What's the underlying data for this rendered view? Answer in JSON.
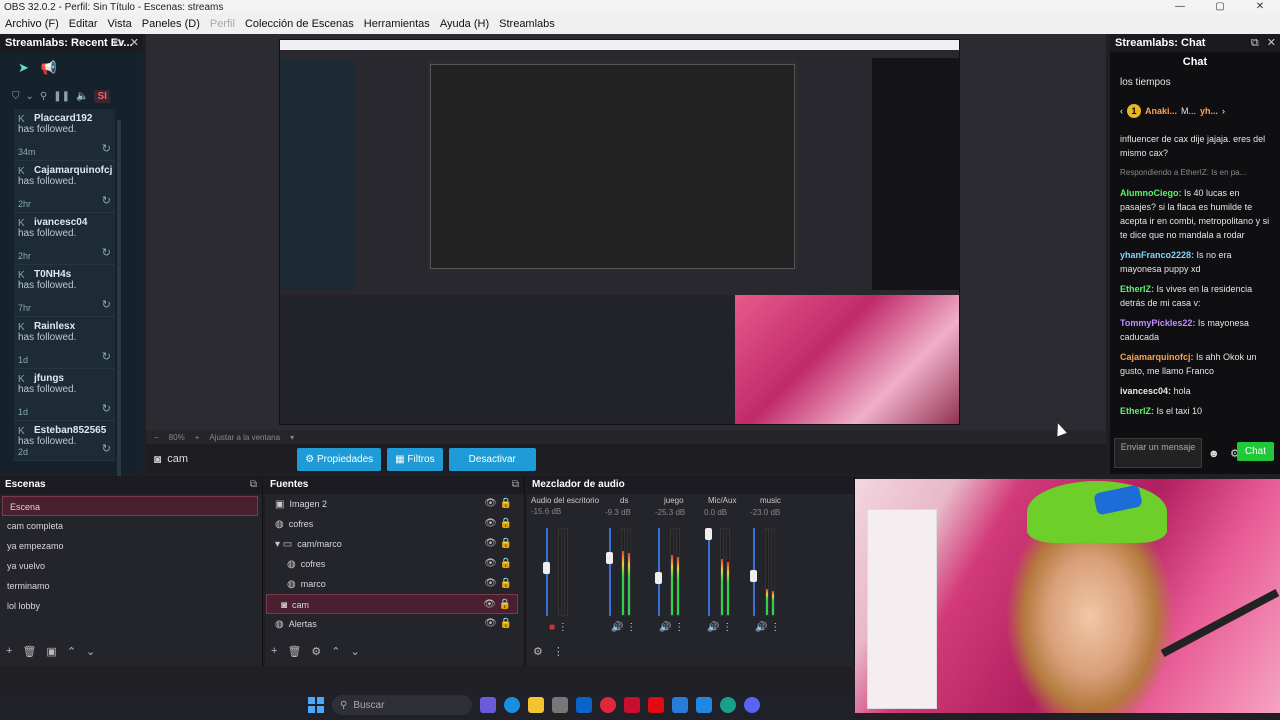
{
  "window": {
    "title": "OBS 32.0.2 - Perfil: Sin Título - Escenas: streams",
    "controls": [
      "—",
      "▢",
      "✕"
    ]
  },
  "menu": [
    {
      "label": "Archivo (F)",
      "disabled": false
    },
    {
      "label": "Editar",
      "disabled": false
    },
    {
      "label": "Vista",
      "disabled": false
    },
    {
      "label": "Paneles (D)",
      "disabled": false
    },
    {
      "label": "Perfil",
      "disabled": true
    },
    {
      "label": "Colección de Escenas",
      "disabled": false
    },
    {
      "label": "Herramientas",
      "disabled": false
    },
    {
      "label": "Ayuda (H)",
      "disabled": false
    },
    {
      "label": "Streamlabs",
      "disabled": false
    }
  ],
  "left_dock": {
    "title": "Streamlabs: Recent Ev...",
    "filter_badge": "SI",
    "events": [
      {
        "name": "Placcard192",
        "action": "has followed.",
        "time": "34m"
      },
      {
        "name": "Cajamarquinofcj",
        "action": "has followed.",
        "time": "2hr"
      },
      {
        "name": "ivancesc04",
        "action": "has followed.",
        "time": "2hr"
      },
      {
        "name": "T0NH4s",
        "action": "has followed.",
        "time": "7hr"
      },
      {
        "name": "Rainlesx",
        "action": "has followed.",
        "time": "1d"
      },
      {
        "name": "jfungs",
        "action": "has followed.",
        "time": "1d"
      },
      {
        "name": "Esteban852565",
        "action": "has followed.",
        "time": "2d"
      }
    ]
  },
  "preview": {
    "zoom": "80%",
    "fit_label": "Ajustar a la ventana"
  },
  "context_bar": {
    "source_name": "cam",
    "properties_label": "Propiedades",
    "filters_label": "Filtros",
    "deactivate_label": "Desactivar"
  },
  "chat_dock": {
    "title": "Streamlabs: Chat",
    "header": "Chat",
    "top_line": "los tiempos",
    "leaderboard": {
      "first": "Anaki...",
      "first_count": "1",
      "second": "M...",
      "second_count": "1",
      "third": "yh...",
      "third_count": "1"
    },
    "messages": [
      {
        "user": "",
        "text": "influencer de cax dije jajaja. eres del mismo cax?",
        "color": "white"
      },
      {
        "user": "",
        "reply": "Respondiendo a EtherIZ: Is en pa...",
        "text": "",
        "color": "reply"
      },
      {
        "user": "AlumnoCiego:",
        "text": "Is 40 lucas en pasajes? si la flaca es humilde te acepta ir en combi, metropolitano y si te dice que no mandala a rodar",
        "color": "green"
      },
      {
        "user": "yhanFranco2228:",
        "text": "Is no era mayonesa puppy xd",
        "color": "blue"
      },
      {
        "user": "EtherIZ:",
        "text": "Is vives en la residencia detrás de mi casa v:",
        "color": "green"
      },
      {
        "user": "TommyPickles22:",
        "text": "Is mayonesa caducada",
        "color": "purple"
      },
      {
        "user": "Cajamarquinofcj:",
        "text": "Is ahh Okok un gusto, me llamo Franco",
        "color": "orange"
      },
      {
        "user": "ivancesc04:",
        "text": "hola",
        "color": "white"
      },
      {
        "user": "EtherIZ:",
        "text": "Is el taxi 10",
        "color": "green"
      }
    ],
    "input_placeholder": "Enviar un mensaje",
    "send_label": "Chat"
  },
  "scenes": {
    "title": "Escenas",
    "items": [
      "Escena",
      "cam completa",
      "ya empezamo",
      "ya vuelvo",
      "terminamo",
      "lol lobby"
    ],
    "selected_index": 0
  },
  "sources": {
    "title": "Fuentes",
    "items": [
      {
        "label": "Imagen 2",
        "icon": "image-icon",
        "indent": 0
      },
      {
        "label": "cofres",
        "icon": "browser-icon",
        "indent": 0
      },
      {
        "label": "cam/marco",
        "icon": "folder-icon",
        "indent": 0
      },
      {
        "label": "cofres",
        "icon": "browser-icon",
        "indent": 1
      },
      {
        "label": "marco",
        "icon": "browser-icon",
        "indent": 1
      },
      {
        "label": "cam",
        "icon": "camera-icon",
        "indent": 1
      },
      {
        "label": "Alertas",
        "icon": "browser-icon",
        "indent": 0
      }
    ],
    "selected_index": 5
  },
  "mixer": {
    "title": "Mezclador de audio",
    "channels": [
      {
        "name": "Audio del escritorio",
        "db": "-15.6 dB",
        "level": 0.0
      },
      {
        "name": "ds",
        "db": "-9.3 dB",
        "level": 0.75
      },
      {
        "name": "juego",
        "db": "-25.3 dB",
        "level": 0.7
      },
      {
        "name": "Mic/Aux",
        "db": "0.0 dB",
        "level": 0.65
      },
      {
        "name": "music",
        "db": "-23.0 dB",
        "level": 0.3
      }
    ],
    "scale": [
      "0",
      "-5",
      "-10",
      "-15",
      "-20",
      "-25",
      "-30",
      "-35",
      "-40",
      "-45",
      "-50",
      "-55",
      "-60"
    ]
  },
  "taskbar": {
    "search_placeholder": "Buscar"
  },
  "colors": {
    "accent": "#1f9bd7",
    "chat_send": "#20c83a",
    "selected_row": "#4a2030",
    "streamlabs_teal": "#5fe3c1"
  }
}
